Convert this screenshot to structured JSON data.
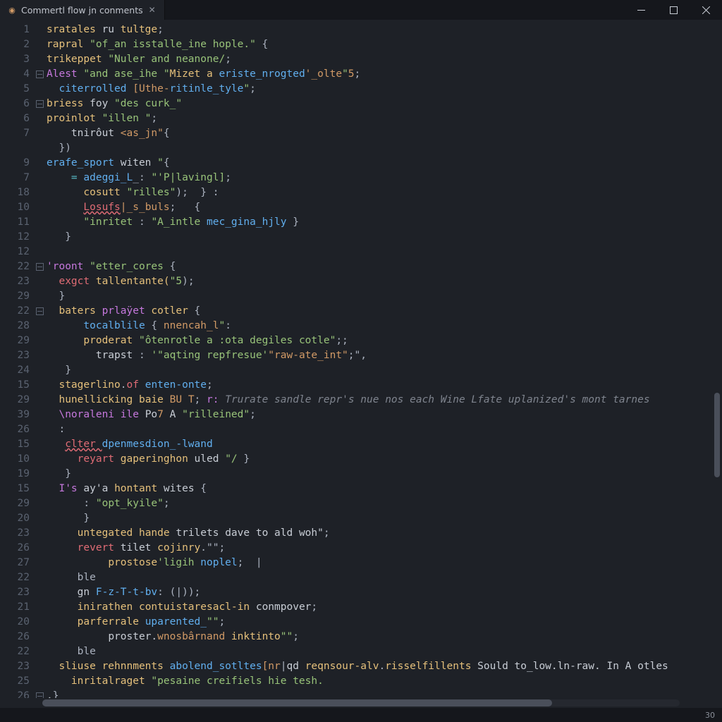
{
  "window": {
    "tab_title": "Commertl flow jn conments",
    "minimize_label": "Minimize",
    "maximize_label": "Maximize",
    "close_label": "Close"
  },
  "status": {
    "right": "30"
  },
  "gutter_numbers": [
    "1",
    "2",
    "3",
    "4",
    "5",
    "6",
    "6",
    "7",
    "",
    "9",
    "7",
    "18",
    "10",
    "11",
    "12",
    "12",
    "22",
    "23",
    "29",
    "22",
    "28",
    "29",
    "23",
    "24",
    "15",
    "29",
    "39",
    "26",
    "15",
    "10",
    "19",
    "15",
    "29",
    "20",
    "23",
    "26",
    "27",
    "22",
    "23",
    "21",
    "20",
    "26",
    "22",
    "23",
    "25",
    "26"
  ],
  "fold_markers": {
    "3": true,
    "5": true,
    "16": true,
    "19": true,
    "45": true
  },
  "lines": [
    [
      [
        "call",
        "sratales"
      ],
      [
        "id",
        " ru "
      ],
      [
        "prop2",
        "tultge"
      ],
      [
        "pn",
        ";"
      ]
    ],
    [
      [
        "call",
        "rapral "
      ],
      [
        "str",
        "\"of_an isstalle_ine hople.\""
      ],
      [
        "pn",
        " {"
      ]
    ],
    [
      [
        "call",
        "trikeppet "
      ],
      [
        "str",
        "\"Nuler and neanone/"
      ],
      [
        "pn",
        ";"
      ]
    ],
    [
      [
        "kw",
        "Alest "
      ],
      [
        "str",
        "\"and ase_ihe \""
      ],
      [
        "call",
        "Mizet a "
      ],
      [
        "def",
        "eriste_nrogted"
      ],
      [
        "prop",
        "'_olte"
      ],
      [
        "str",
        "\""
      ],
      [
        "num",
        "5"
      ],
      [
        "pn",
        ";"
      ]
    ],
    [
      [
        "id",
        "  "
      ],
      [
        "def",
        "citerrolled "
      ],
      [
        "prop",
        "[Uthe-"
      ],
      [
        "def",
        "ritinle_tyle"
      ],
      [
        "str",
        "\""
      ],
      [
        "pn",
        ";"
      ]
    ],
    [
      [
        "call",
        "briess"
      ],
      [
        "id",
        " foy "
      ],
      [
        "str",
        "\"des curk_\""
      ]
    ],
    [
      [
        "call",
        "proinlot "
      ],
      [
        "str",
        "\"illen \""
      ],
      [
        "pn",
        ";"
      ]
    ],
    [
      [
        "id",
        "    "
      ],
      [
        "id",
        "tnirôut "
      ],
      [
        "prop",
        "<as_jn\""
      ],
      [
        "pn",
        "{"
      ]
    ],
    [
      [
        "id",
        "  "
      ],
      [
        "pn",
        "})"
      ]
    ],
    [
      [
        "def",
        "erafe_sport"
      ],
      [
        "id",
        " witen "
      ],
      [
        "str",
        "\""
      ],
      [
        "pn",
        "{"
      ]
    ],
    [
      [
        "id",
        "    "
      ],
      [
        "op",
        "= "
      ],
      [
        "def",
        "adeggi_L"
      ],
      [
        "pn",
        "_: "
      ],
      [
        "str",
        "\"'P|lavingl]"
      ],
      [
        "pn",
        ";"
      ]
    ],
    [
      [
        "id",
        "      "
      ],
      [
        "call",
        "cosutt "
      ],
      [
        "str",
        "\"rilles\""
      ],
      [
        "pn",
        ");  } :"
      ]
    ],
    [
      [
        "id",
        "      "
      ],
      [
        "err",
        "Losufs"
      ],
      [
        "prop",
        "|_s_buls"
      ],
      [
        "pn",
        ";   {"
      ]
    ],
    [
      [
        "id",
        "      "
      ],
      [
        "str",
        "\"inritet "
      ],
      [
        "pn",
        ": "
      ],
      [
        "str",
        "\"A_intle "
      ],
      [
        "def",
        "mec_gina_hjly"
      ],
      [
        "pn",
        " }"
      ]
    ],
    [
      [
        "id",
        "   "
      ],
      [
        "pn",
        "}"
      ]
    ],
    [
      []
    ],
    [
      [
        "kw",
        "'roont "
      ],
      [
        "str",
        "\"etter_cores"
      ],
      [
        "pn",
        " {"
      ]
    ],
    [
      [
        "id",
        "  "
      ],
      [
        "kw2",
        "exgct "
      ],
      [
        "call",
        "tallentante("
      ],
      [
        "str",
        "\"5"
      ],
      [
        "pn",
        ");"
      ]
    ],
    [
      [
        "id",
        "  "
      ],
      [
        "pn",
        "}"
      ]
    ],
    [
      [
        "id",
        "  "
      ],
      [
        "call",
        "baters "
      ],
      [
        "kw",
        "prlaÿet "
      ],
      [
        "prop2",
        "cotler"
      ],
      [
        "pn",
        " {"
      ]
    ],
    [
      [
        "id",
        "      "
      ],
      [
        "def",
        "tocalblile"
      ],
      [
        "pn",
        " { "
      ],
      [
        "prop",
        "nnencah_l"
      ],
      [
        "str",
        "\""
      ],
      [
        "pn",
        ":"
      ]
    ],
    [
      [
        "id",
        "      "
      ],
      [
        "call",
        "proderat "
      ],
      [
        "str",
        "\"ôtenrotle a :ota degiles cotle\""
      ],
      [
        "pn",
        ";;"
      ]
    ],
    [
      [
        "id",
        "        "
      ],
      [
        "id",
        "trapst "
      ],
      [
        "pn",
        ": "
      ],
      [
        "str",
        "'\"aqting repfresue'"
      ],
      [
        "prop",
        "\"raw-ate_int\""
      ],
      [
        "pn",
        ";\","
      ]
    ],
    [
      [
        "id",
        "   "
      ],
      [
        "pn",
        "}"
      ]
    ],
    [
      [
        "id",
        "  "
      ],
      [
        "prop2",
        "stagerlino"
      ],
      [
        "pn",
        "."
      ],
      [
        "kw2",
        "of "
      ],
      [
        "def",
        "enten-onte"
      ],
      [
        "pn",
        ";"
      ]
    ],
    [
      [
        "id",
        "  "
      ],
      [
        "prop2",
        "hunellicking "
      ],
      [
        "call",
        "baie "
      ],
      [
        "num",
        "BU T"
      ],
      [
        "pn",
        "; "
      ],
      [
        "kw",
        "r: "
      ],
      [
        "cm",
        "Trurate sandle repr's nue nos each Wine Lfate uplanized's mont tarnes"
      ]
    ],
    [
      [
        "id",
        "  "
      ],
      [
        "kw",
        "\\noraleni ile "
      ],
      [
        "id",
        "Po"
      ],
      [
        "num",
        "7"
      ],
      [
        "id",
        " A "
      ],
      [
        "str",
        "\"rilleined\""
      ],
      [
        "pn",
        ";"
      ]
    ],
    [
      [
        "id",
        "  "
      ],
      [
        "pn",
        ":"
      ]
    ],
    [
      [
        "id",
        "   "
      ],
      [
        "err",
        "clter "
      ],
      [
        "def",
        "dpenmesdion_-lwand"
      ]
    ],
    [
      [
        "id",
        "     "
      ],
      [
        "kw2",
        "reyart "
      ],
      [
        "call",
        "gaperinghon "
      ],
      [
        "id",
        "uled "
      ],
      [
        "str",
        "\"/"
      ],
      [
        "pn",
        " }"
      ]
    ],
    [
      [
        "id",
        "   "
      ],
      [
        "pn",
        "}"
      ]
    ],
    [
      [
        "id",
        "  "
      ],
      [
        "kw",
        "I's"
      ],
      [
        "id",
        " ay'a "
      ],
      [
        "call",
        "hontant "
      ],
      [
        "id",
        "wites "
      ],
      [
        "pn",
        "{"
      ]
    ],
    [
      [
        "id",
        "      "
      ],
      [
        "pn",
        ": "
      ],
      [
        "str",
        "\"opt_kyile\""
      ],
      [
        "pn",
        ";"
      ]
    ],
    [
      [
        "id",
        "      "
      ],
      [
        "pn",
        "}"
      ]
    ],
    [
      [
        "id",
        "     "
      ],
      [
        "prop2",
        "untegated "
      ],
      [
        "call",
        "hande "
      ],
      [
        "id",
        "trilets dave to ald woh\""
      ],
      [
        "pn",
        ";"
      ]
    ],
    [
      [
        "id",
        "     "
      ],
      [
        "kw2",
        "revert "
      ],
      [
        "id",
        "tilet "
      ],
      [
        "call",
        "cojinry"
      ],
      [
        "pn",
        ".\"\";"
      ]
    ],
    [
      [
        "id",
        "          "
      ],
      [
        "call",
        "prostose"
      ],
      [
        "str",
        "'ligih "
      ],
      [
        "def",
        "noplel"
      ],
      [
        "pn",
        ";  |"
      ]
    ],
    [
      [
        "id",
        "     "
      ],
      [
        "pn",
        "ble"
      ]
    ],
    [
      [
        "id",
        "     "
      ],
      [
        "id",
        "gn "
      ],
      [
        "def",
        "F-z-T-t-bv"
      ],
      [
        "pn",
        ": (|));"
      ]
    ],
    [
      [
        "id",
        "     "
      ],
      [
        "call",
        "inirathen "
      ],
      [
        "prop2",
        "contuistaresacl-in "
      ],
      [
        "id",
        "conmpover"
      ],
      [
        "pn",
        ";"
      ]
    ],
    [
      [
        "id",
        "     "
      ],
      [
        "call",
        "parferrale "
      ],
      [
        "def",
        "uparented_"
      ],
      [
        "str",
        "\"\""
      ],
      [
        "pn",
        ";"
      ]
    ],
    [
      [
        "id",
        "          "
      ],
      [
        "id",
        "proster."
      ],
      [
        "prop",
        "wnosbârnand "
      ],
      [
        "call",
        "inktinto"
      ],
      [
        "str",
        "\"\""
      ],
      [
        "pn",
        ";"
      ]
    ],
    [
      [
        "id",
        "     "
      ],
      [
        "pn",
        "ble"
      ]
    ],
    [
      [
        "id",
        "  "
      ],
      [
        "prop2",
        "sliuse "
      ],
      [
        "call",
        "rehnnments "
      ],
      [
        "def",
        "abolend_sotltes"
      ],
      [
        "prop",
        "[nr"
      ],
      [
        "pn",
        "|"
      ],
      [
        "id",
        "qd "
      ],
      [
        "call",
        "reqnsour-alv"
      ],
      [
        "pn",
        "."
      ],
      [
        "prop2",
        "risselfillents "
      ],
      [
        "id",
        "Sould to_low.ln-raw. In A otles"
      ]
    ],
    [
      [
        "id",
        "    "
      ],
      [
        "call",
        "inritalraget "
      ],
      [
        "str",
        "\"pesaine creifiels hie tesh."
      ]
    ],
    [
      [
        "id",
        "."
      ],
      [
        "pn",
        "}"
      ]
    ]
  ]
}
